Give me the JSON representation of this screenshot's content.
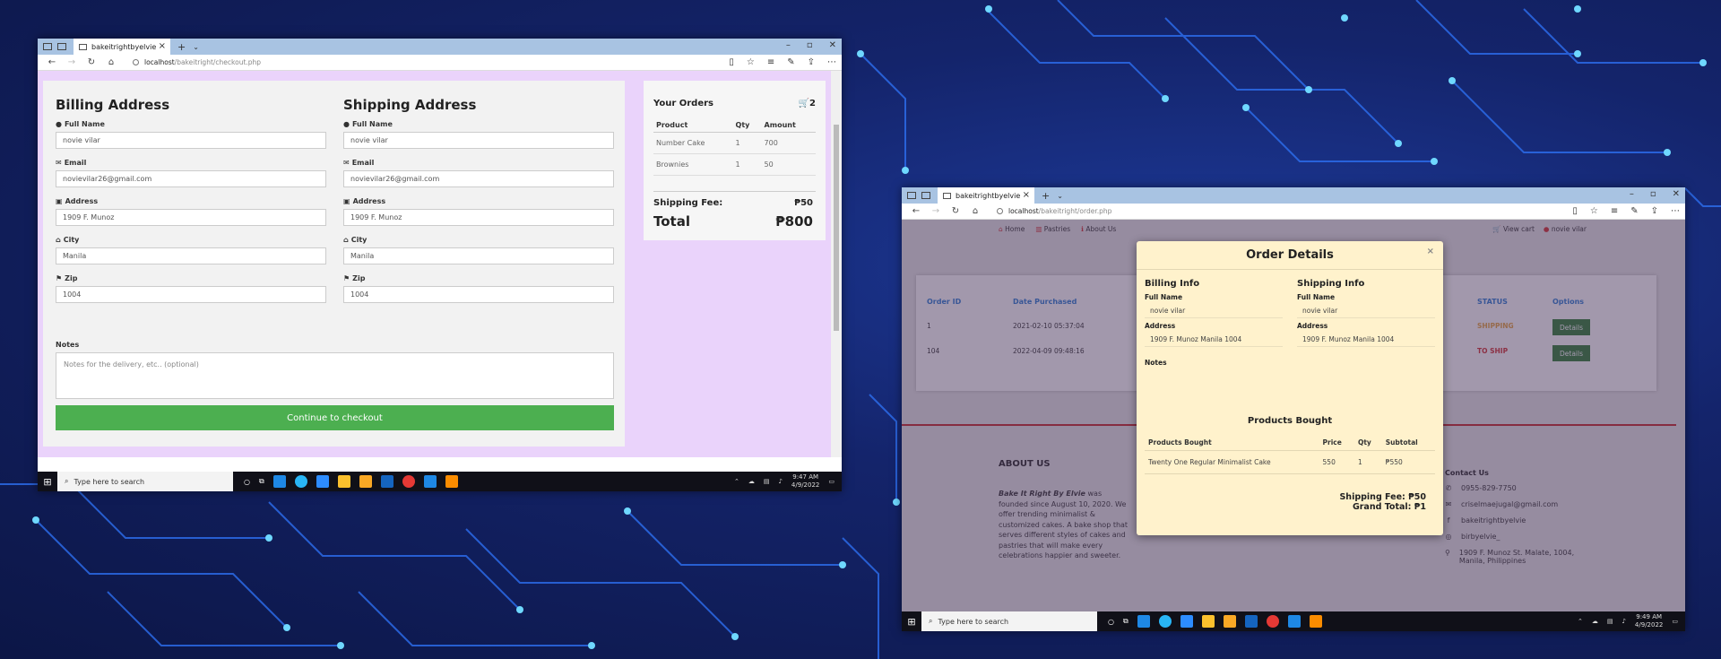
{
  "checkout_window": {
    "tab_title": "bakeitrightbyelvie",
    "url_host": "localhost",
    "url_path": "/bakeitright/checkout.php",
    "billing": {
      "heading": "Billing Address",
      "full_name_label": "Full Name",
      "full_name": "novie vilar",
      "email_label": "Email",
      "email": "novievilar26@gmail.com",
      "address_label": "Address",
      "address": "1909 F. Munoz",
      "city_label": "City",
      "city": "Manila",
      "zip_label": "Zip",
      "zip": "1004"
    },
    "shipping": {
      "heading": "Shipping Address",
      "full_name_label": "Full Name",
      "full_name": "novie vilar",
      "email_label": "Email",
      "email": "novievilar26@gmail.com",
      "address_label": "Address",
      "address": "1909 F. Munoz",
      "city_label": "City",
      "city": "Manila",
      "zip_label": "Zip",
      "zip": "1004"
    },
    "notes_label": "Notes",
    "notes_placeholder": "Notes for the delivery, etc.. (optional)",
    "checkout_button": "Continue to checkout",
    "orders": {
      "heading": "Your Orders",
      "cart_count": "2",
      "columns": [
        "Product",
        "Qty",
        "Amount"
      ],
      "rows": [
        {
          "product": "Number Cake",
          "qty": "1",
          "amount": "700"
        },
        {
          "product": "Brownies",
          "qty": "1",
          "amount": "50"
        }
      ],
      "shipping_fee_label": "Shipping Fee:",
      "shipping_fee": "₱50",
      "total_label": "Total",
      "total": "₱800"
    },
    "taskbar": {
      "search_placeholder": "Type here to search",
      "time": "9:47 AM",
      "date": "4/9/2022"
    }
  },
  "order_window": {
    "tab_title": "bakeitrightbyelvie",
    "url_host": "localhost",
    "url_path": "/bakeitright/order.php",
    "nav": {
      "home": "Home",
      "pastries": "Pastries",
      "about": "About Us",
      "view_cart": "View cart",
      "user": "novie vilar"
    },
    "orders_table": {
      "columns": [
        "Order ID",
        "Date Purchased",
        "STATUS",
        "Options"
      ],
      "rows": [
        {
          "id": "1",
          "date": "2021-02-10 05:37:04",
          "status": "SHIPPING",
          "option": "Details"
        },
        {
          "id": "104",
          "date": "2022-04-09 09:48:16",
          "status": "TO SHIP",
          "option": "Details"
        }
      ]
    },
    "footer": {
      "about_heading": "ABOUT US",
      "about_brand": "Bake It Right By Elvie",
      "about_text": " was founded since August 10, 2020. We offer trending minimalist & customized cakes. A bake shop that serves different styles of cakes and pastries that will make every celebrations happier and sweeter.",
      "contact_heading": "Contact Us",
      "phone": "0955-829-7750",
      "email": "criselmaejugal@gmail.com",
      "facebook": "bakeitrightbyelvie",
      "instagram": "birbyelvie_",
      "address": "1909 F. Munoz St. Malate, 1004, Manila, Philippines"
    },
    "modal": {
      "title": "Order Details",
      "close": "×",
      "billing_heading": "Billing Info",
      "shipping_heading": "Shipping Info",
      "full_name_label": "Full Name",
      "address_label": "Address",
      "billing_name": "novie vilar",
      "billing_address": "1909 F. Munoz Manila 1004",
      "shipping_name": "novie vilar",
      "shipping_address": "1909 F. Munoz Manila 1004",
      "notes_label": "Notes",
      "products_heading": "Products Bought",
      "product_columns": [
        "Products Bought",
        "Price",
        "Qty",
        "Subtotal"
      ],
      "products": [
        {
          "name": "Twenty One Regular Minimalist Cake",
          "price": "550",
          "qty": "1",
          "subtotal": "₱550"
        }
      ],
      "shipping_fee": "Shipping Fee: ₱50",
      "grand_total": "Grand Total: ₱1"
    },
    "taskbar": {
      "search_placeholder": "Type here to search",
      "time": "9:49 AM",
      "date": "4/9/2022"
    }
  },
  "colors": {
    "checkout_bg": "#ead3fb",
    "button_green": "#4caf50",
    "status_orange": "#e6a23c",
    "status_red": "#d32f2f",
    "modal_bg": "#fff2cc"
  }
}
